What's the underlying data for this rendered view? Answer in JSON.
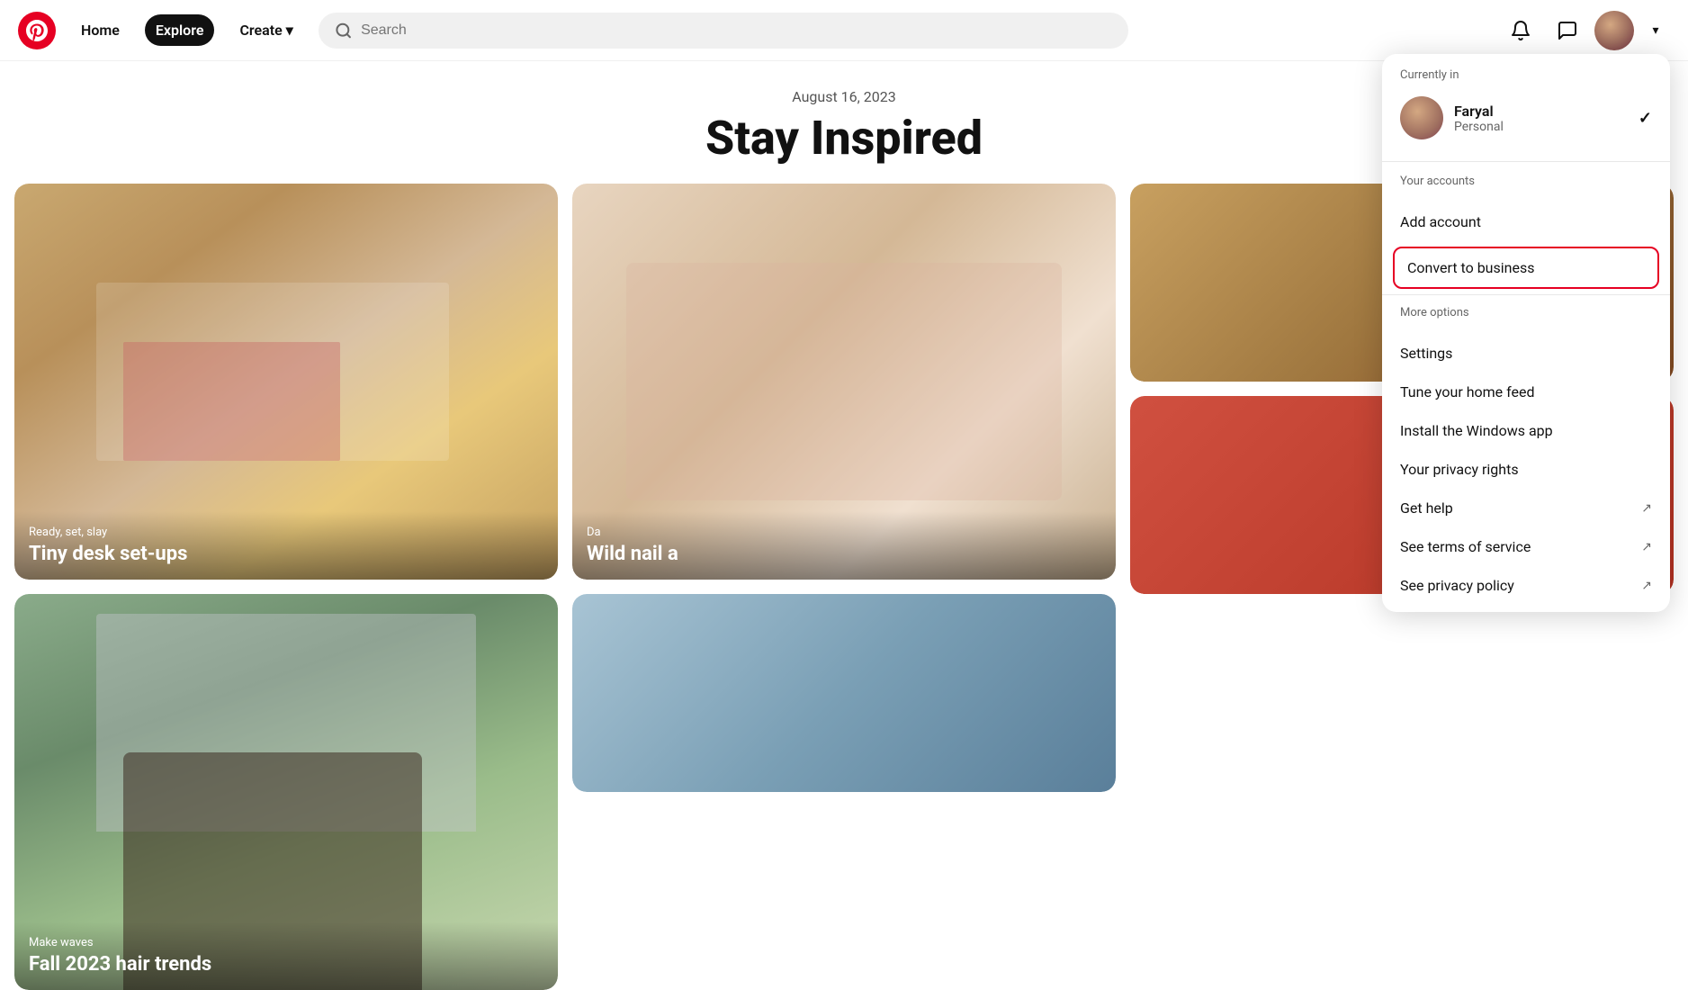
{
  "navbar": {
    "home_label": "Home",
    "explore_label": "Explore",
    "create_label": "Create",
    "search_placeholder": "Search"
  },
  "feed": {
    "date": "August 16, 2023",
    "title": "Stay Inspired",
    "cards": [
      {
        "subtitle": "Ready, set, slay",
        "title": "Tiny desk set-ups",
        "height": "420"
      },
      {
        "subtitle": "Make waves",
        "title": "Fall 2023 hair trends",
        "height": "420"
      },
      {
        "subtitle": "Da",
        "title": "Wild nail a",
        "height": "420"
      }
    ]
  },
  "dropdown": {
    "currently_in_label": "Currently in",
    "user_name": "Faryal",
    "user_type": "Personal",
    "your_accounts_label": "Your accounts",
    "add_account_label": "Add account",
    "convert_business_label": "Convert to business",
    "more_options_label": "More options",
    "settings_label": "Settings",
    "tune_feed_label": "Tune your home feed",
    "install_windows_label": "Install the Windows app",
    "privacy_rights_label": "Your privacy rights",
    "get_help_label": "Get help",
    "terms_of_service_label": "See terms of service",
    "privacy_policy_label": "See privacy policy"
  }
}
